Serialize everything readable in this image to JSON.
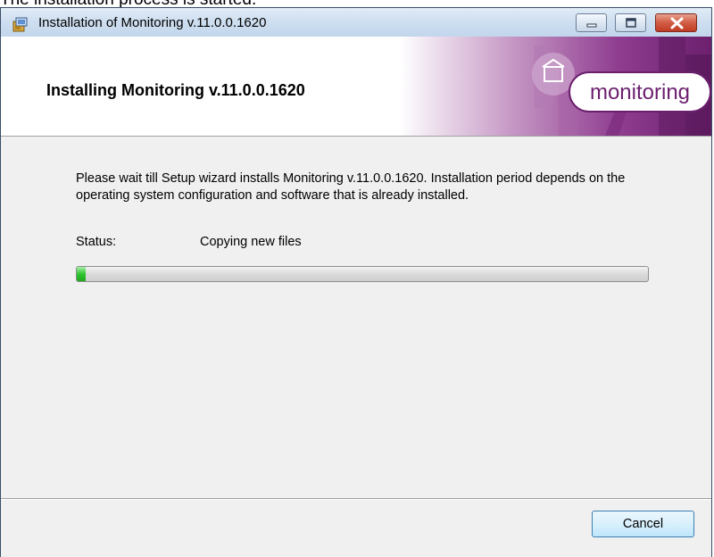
{
  "caption": "The installation process is started.",
  "window": {
    "title": "Installation of Monitoring v.11.0.0.1620",
    "header_title": "Installing Monitoring v.11.0.0.1620",
    "brand_logo_text": "monitoring",
    "brand_color": "#8a2e8c"
  },
  "content": {
    "description": "Please wait till Setup wizard installs Monitoring v.11.0.0.1620. Installation period depends on the operating system configuration and software that is already installed.",
    "status_label": "Status:",
    "status_value": "Copying new files",
    "progress_fraction": 0.015
  },
  "buttons": {
    "cancel_label": "Cancel"
  },
  "icons": {
    "app": "installer-icon",
    "minimize": "minimize-icon",
    "maximize": "maximize-icon",
    "close": "close-icon"
  }
}
